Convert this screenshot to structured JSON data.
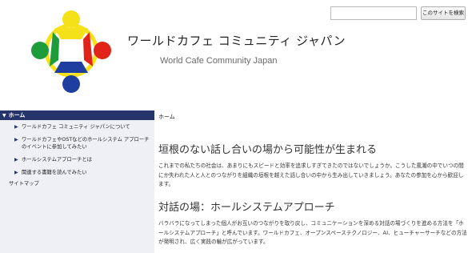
{
  "header": {
    "site_title": "ワールドカフェ コミュニティ ジャパン",
    "site_subtitle": "World Cafe Community Japan",
    "logo_icon": "circle-of-people-logo-icon",
    "logo_colors": {
      "yellow": "#f5e11a",
      "red": "#e2231a",
      "blue": "#1f3fa0",
      "green": "#1e9c3b"
    }
  },
  "search": {
    "value": "",
    "button_label": "このサイトを検索"
  },
  "sidebar": {
    "home_label": "ホーム",
    "items": [
      {
        "label": "ワールドカフェ コミュニティ ジャパンについて"
      },
      {
        "label": "ワールドカフェやOSTなどのホールシステム アプローチのイベントに参加してみたい"
      },
      {
        "label": "ホールシステムアプローチとは"
      },
      {
        "label": "関連する書籍を読んでみたい"
      }
    ],
    "sitemap_label": "サイトマップ",
    "colors": {
      "home_bg": "#25346a",
      "panel_bg": "#eef0f6"
    }
  },
  "main": {
    "breadcrumb": "ホーム",
    "sections": [
      {
        "heading": "垣根のない話し合いの場から可能性が生まれる",
        "body": "これまでの私たちの社会は、あまりにもスピードと効率を追求しすぎてきたのではないでしょうか。こうした風潮の中でいつの間にか失われた人と人とのつながりを組織の垣根を越えた話し合いの中から生み出していきましょう。あなたの参加を心から歓迎します。"
      },
      {
        "heading": "対話の場：ホールシステムアプローチ",
        "body": "バラバラになってしまった個人がお互いのつながりを取り戻し、コミュニケーションを深める対話の場づくりを進める方法を「ホールシステムアプローチ」と呼んでいます。ワールドカフェ、オープンスペーステクノロジー、AI、ヒューチャーサーチなどの方法が発明され、広く実践の輪が広がっています。"
      }
    ]
  }
}
